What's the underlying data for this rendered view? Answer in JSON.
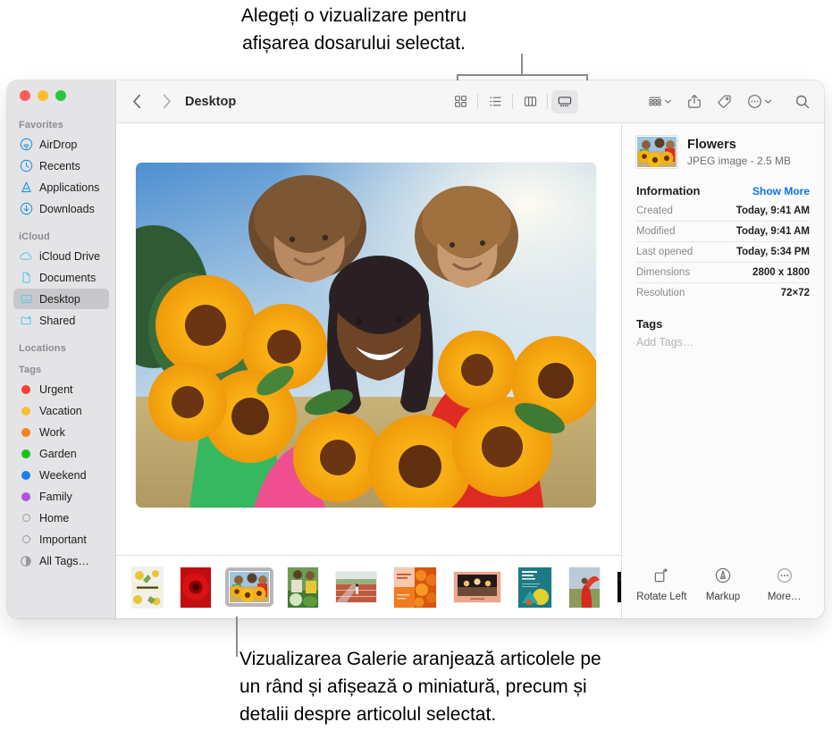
{
  "callouts": {
    "top": "Alegeți o vizualizare pentru\nafișarea dosarului selectat.",
    "bottom": "Vizualizarea Galerie aranjează articolele pe\nun rând și afișează o miniatură, precum și\ndetalii despre articolul selectat."
  },
  "window": {
    "traffic_lights": [
      "close",
      "minimize",
      "zoom"
    ]
  },
  "toolbar": {
    "back_icon": "chevron-left-icon",
    "forward_icon": "chevron-right-icon",
    "breadcrumb": "Desktop",
    "views": [
      {
        "name": "icon-view",
        "label": "Icon view",
        "active": false
      },
      {
        "name": "list-view",
        "label": "List view",
        "active": false
      },
      {
        "name": "column-view",
        "label": "Column view",
        "active": false
      },
      {
        "name": "gallery-view",
        "label": "Gallery view",
        "active": true
      }
    ],
    "right_items": [
      {
        "name": "group-by-button",
        "label": "Group",
        "chevron": true
      },
      {
        "name": "share-button",
        "label": "Share",
        "chevron": false
      },
      {
        "name": "tag-button",
        "label": "Tags",
        "chevron": false
      },
      {
        "name": "more-actions-button",
        "label": "More",
        "chevron": true
      },
      {
        "name": "search-button",
        "label": "Search",
        "chevron": false
      }
    ]
  },
  "sidebar": {
    "sections": [
      {
        "header": "Favorites",
        "items": [
          {
            "label": "AirDrop",
            "icon": "airdrop-icon",
            "selected": false
          },
          {
            "label": "Recents",
            "icon": "clock-icon",
            "selected": false
          },
          {
            "label": "Applications",
            "icon": "applications-icon",
            "selected": false
          },
          {
            "label": "Downloads",
            "icon": "downloads-icon",
            "selected": false
          }
        ]
      },
      {
        "header": "iCloud",
        "items": [
          {
            "label": "iCloud Drive",
            "icon": "cloud-icon",
            "selected": false
          },
          {
            "label": "Documents",
            "icon": "document-icon",
            "selected": false
          },
          {
            "label": "Desktop",
            "icon": "desktop-icon",
            "selected": true
          },
          {
            "label": "Shared",
            "icon": "shared-folder-icon",
            "selected": false
          }
        ]
      },
      {
        "header": "Locations",
        "items": []
      },
      {
        "header": "Tags",
        "items": [
          {
            "label": "Urgent",
            "icon": "tag-dot-icon",
            "color": "#fc3b30",
            "selected": false
          },
          {
            "label": "Vacation",
            "icon": "tag-dot-icon",
            "color": "#fdbc2e",
            "selected": false
          },
          {
            "label": "Work",
            "icon": "tag-dot-icon",
            "color": "#f7821b",
            "selected": false
          },
          {
            "label": "Garden",
            "icon": "tag-dot-icon",
            "color": "#1bc21b",
            "selected": false
          },
          {
            "label": "Weekend",
            "icon": "tag-dot-icon",
            "color": "#1a7ef5",
            "selected": false
          },
          {
            "label": "Family",
            "icon": "tag-dot-icon",
            "color": "#b martial",
            "selected": false
          },
          {
            "label": "Home",
            "icon": "tag-ring-icon",
            "color": "",
            "selected": false
          },
          {
            "label": "Important",
            "icon": "tag-ring-icon",
            "color": "",
            "selected": false
          },
          {
            "label": "All Tags…",
            "icon": "all-tags-icon",
            "color": "",
            "selected": false
          }
        ]
      }
    ]
  },
  "gallery": {
    "hero_alt": "Three people holding bouquets of sunflowers in a field",
    "thumbnails": [
      {
        "name": "thumb-district-poster",
        "kind": "poster-lemons",
        "w": 34,
        "h": 45,
        "selected": false
      },
      {
        "name": "thumb-red-flower",
        "kind": "photo-red-dahlia",
        "w": 34,
        "h": 45,
        "selected": false
      },
      {
        "name": "thumb-flowers",
        "kind": "photo-sunflowers",
        "w": 44,
        "h": 34,
        "selected": true
      },
      {
        "name": "thumb-garden",
        "kind": "photo-garden",
        "w": 34,
        "h": 45,
        "selected": false
      },
      {
        "name": "thumb-track",
        "kind": "photo-running-track",
        "w": 45,
        "h": 34,
        "selected": false
      },
      {
        "name": "thumb-pumpkin-flyer",
        "kind": "poster-pumpkins",
        "w": 47,
        "h": 45,
        "selected": false
      },
      {
        "name": "thumb-dinner-card",
        "kind": "photo-dinner-frame",
        "w": 52,
        "h": 34,
        "selected": false
      },
      {
        "name": "thumb-marketing-plan",
        "kind": "poster-marketing",
        "w": 37,
        "h": 45,
        "selected": false
      },
      {
        "name": "thumb-red-scarf",
        "kind": "photo-red-scarf",
        "w": 34,
        "h": 45,
        "selected": false
      },
      {
        "name": "thumb-dark-leaf",
        "kind": "photo-dark",
        "w": 48,
        "h": 34,
        "selected": false
      },
      {
        "name": "thumb-partial-doc",
        "kind": "doc-partial",
        "w": 30,
        "h": 45,
        "selected": false
      }
    ]
  },
  "info": {
    "title": "Flowers",
    "subtitle": "JPEG image - 2.5 MB",
    "section_title": "Information",
    "show_more": "Show More",
    "rows": [
      {
        "key": "Created",
        "value": "Today, 9:41 AM"
      },
      {
        "key": "Modified",
        "value": "Today, 9:41 AM"
      },
      {
        "key": "Last opened",
        "value": "Today, 5:34 PM"
      },
      {
        "key": "Dimensions",
        "value": "2800 x 1800"
      },
      {
        "key": "Resolution",
        "value": "72×72"
      }
    ],
    "tags_title": "Tags",
    "add_tags_placeholder": "Add Tags…",
    "actions": [
      {
        "name": "rotate-left-button",
        "label": "Rotate Left",
        "icon": "rotate-left-icon"
      },
      {
        "name": "markup-button",
        "label": "Markup",
        "icon": "markup-icon"
      },
      {
        "name": "more-button",
        "label": "More…",
        "icon": "ellipsis-circle-icon"
      }
    ]
  },
  "colors": {
    "accent": "#0a72e8",
    "sidebar_bg": "#e4e4e6",
    "toolbar_bg": "#f6f6f7",
    "selection": "#c8c8cb"
  }
}
